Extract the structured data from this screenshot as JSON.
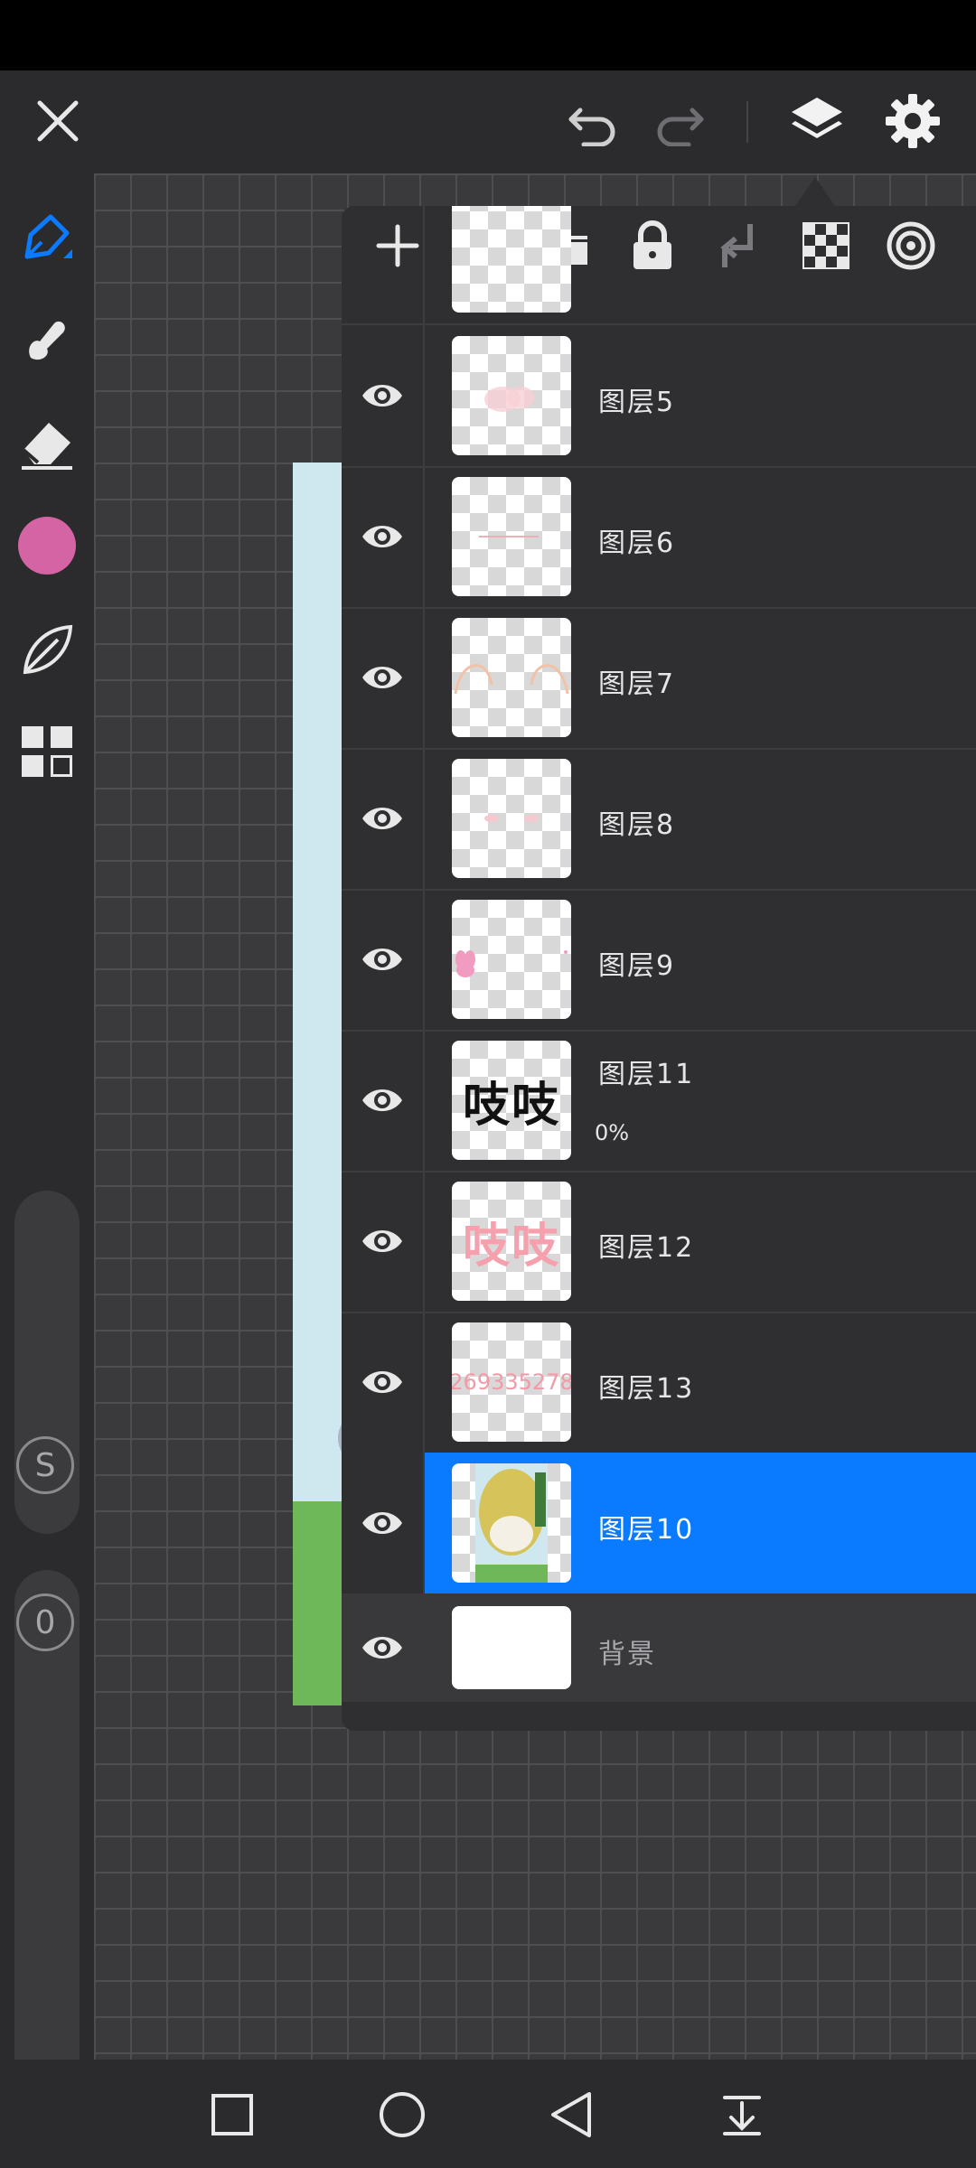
{
  "colors": {
    "accent": "#0a7bff",
    "brush_color": "#d564a5",
    "selected_layer": "#0a7bff"
  },
  "topbar": {
    "icons": [
      "close-icon",
      "undo-icon",
      "redo-icon",
      "layers-icon",
      "settings-icon"
    ]
  },
  "toolbar": {
    "tools": [
      "pen-icon",
      "smudge-icon",
      "eraser-icon",
      "color-swatch",
      "leaf-icon",
      "grid-icon"
    ]
  },
  "sliders": {
    "size_label": "S",
    "opacity_label": "0"
  },
  "layer_panel": {
    "actions": [
      "add-icon",
      "folder-icon",
      "lock-icon",
      "merge-down-icon",
      "transparency-icon",
      "target-icon"
    ],
    "layers": [
      {
        "name": "图层5",
        "visible": true,
        "thumb": "bunny-ears"
      },
      {
        "name": "图层6",
        "visible": true,
        "thumb": "line"
      },
      {
        "name": "图层7",
        "visible": true,
        "thumb": "arcs"
      },
      {
        "name": "图层8",
        "visible": true,
        "thumb": "blush"
      },
      {
        "name": "图层9",
        "visible": true,
        "thumb": "bunny-icon"
      },
      {
        "name": "图层11",
        "visible": true,
        "thumb_text": "吱吱",
        "opacity": "0%"
      },
      {
        "name": "图层12",
        "visible": true,
        "thumb_text": "吱吱"
      },
      {
        "name": "图层13",
        "visible": true,
        "thumb_text": "269335278"
      },
      {
        "name": "图层10",
        "visible": true,
        "selected": true,
        "thumb": "artwork"
      },
      {
        "name": "背景",
        "visible": true,
        "thumb": "white"
      }
    ]
  },
  "navbar": {
    "icons": [
      "recents-square-icon",
      "home-circle-icon",
      "back-triangle-icon",
      "notification-down-icon"
    ]
  }
}
